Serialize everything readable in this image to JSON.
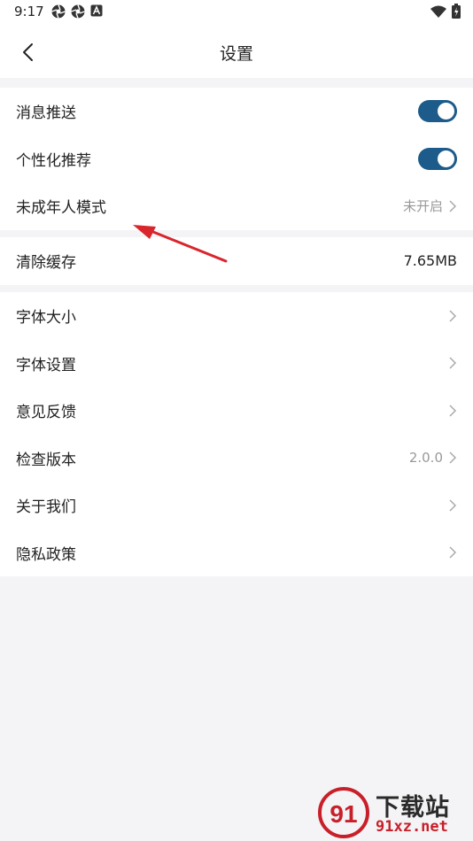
{
  "status_bar": {
    "time": "9:17",
    "left_icons": [
      "aperture-icon",
      "aperture-icon",
      "a-box-icon"
    ],
    "right_icons": [
      "wifi-icon",
      "battery-icon"
    ]
  },
  "header": {
    "title": "设置",
    "back_icon": "chevron-left-icon"
  },
  "groups": [
    {
      "items": [
        {
          "label": "消息推送",
          "type": "toggle",
          "on": true
        },
        {
          "label": "个性化推荐",
          "type": "toggle",
          "on": true
        },
        {
          "label": "未成年人模式",
          "type": "link",
          "value": "未开启"
        }
      ]
    },
    {
      "items": [
        {
          "label": "清除缓存",
          "type": "value",
          "value": "7.65MB"
        }
      ]
    },
    {
      "items": [
        {
          "label": "字体大小",
          "type": "link"
        },
        {
          "label": "字体设置",
          "type": "link"
        },
        {
          "label": "意见反馈",
          "type": "link"
        },
        {
          "label": "检查版本",
          "type": "link",
          "value": "2.0.0"
        },
        {
          "label": "关于我们",
          "type": "link"
        },
        {
          "label": "隐私政策",
          "type": "link"
        }
      ]
    }
  ],
  "colors": {
    "toggle_on": "#1c5b8a",
    "annotation_arrow": "#d8262c",
    "watermark_red": "#c8202a"
  },
  "watermark": {
    "logo_text": "91",
    "title": "下载站",
    "url": "91xz.net"
  }
}
